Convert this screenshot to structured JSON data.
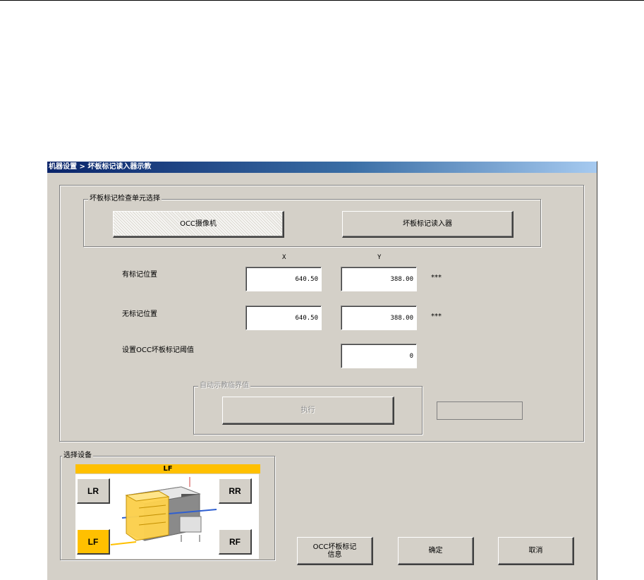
{
  "window": {
    "title": "机器设置 > 坏板标记读入器示教"
  },
  "unit_select": {
    "title": "坏板标记检查单元选择",
    "occ_camera_label": "OCC摄像机",
    "bad_mark_reader_label": "坏板标记读入器"
  },
  "positions": {
    "x_header": "X",
    "y_header": "Y",
    "marked_label": "有标记位置",
    "marked_x": "640.50",
    "marked_y": "388.00",
    "marked_status": "***",
    "unmarked_label": "无标记位置",
    "unmarked_x": "640.50",
    "unmarked_y": "388.00",
    "unmarked_status": "***",
    "threshold_label": "设置OCC坏板标记阈值",
    "threshold_value": "0"
  },
  "auto_teach": {
    "title": "自动示教临界值",
    "execute_label": "执行",
    "result_value": ""
  },
  "device_select": {
    "title": "选择设备",
    "current": "LF",
    "buttons": {
      "lr": "LR",
      "rr": "RR",
      "lf": "LF",
      "rf": "RF"
    },
    "highlight_color": "#ffc000"
  },
  "footer": {
    "occ_info_line1": "OCC坏板标记",
    "occ_info_line2": "信息",
    "ok_label": "确定",
    "cancel_label": "取消"
  }
}
